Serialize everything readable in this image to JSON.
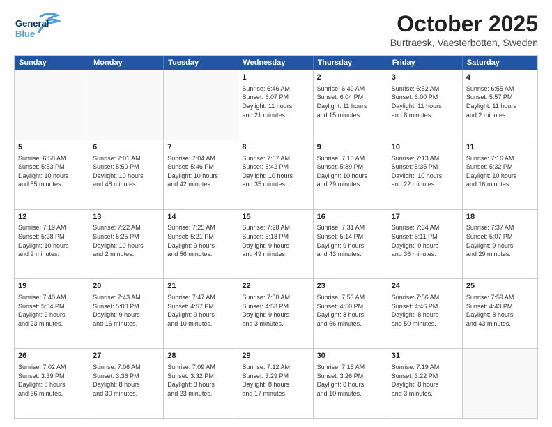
{
  "logo": {
    "line1": "General",
    "line2": "Blue"
  },
  "title": "October 2025",
  "subtitle": "Burtraesk, Vaesterbotten, Sweden",
  "weekdays": [
    "Sunday",
    "Monday",
    "Tuesday",
    "Wednesday",
    "Thursday",
    "Friday",
    "Saturday"
  ],
  "rows": [
    [
      {
        "day": "",
        "lines": []
      },
      {
        "day": "",
        "lines": []
      },
      {
        "day": "",
        "lines": []
      },
      {
        "day": "1",
        "lines": [
          "Sunrise: 6:46 AM",
          "Sunset: 6:07 PM",
          "Daylight: 11 hours",
          "and 21 minutes."
        ]
      },
      {
        "day": "2",
        "lines": [
          "Sunrise: 6:49 AM",
          "Sunset: 6:04 PM",
          "Daylight: 11 hours",
          "and 15 minutes."
        ]
      },
      {
        "day": "3",
        "lines": [
          "Sunrise: 6:52 AM",
          "Sunset: 6:00 PM",
          "Daylight: 11 hours",
          "and 8 minutes."
        ]
      },
      {
        "day": "4",
        "lines": [
          "Sunrise: 6:55 AM",
          "Sunset: 5:57 PM",
          "Daylight: 11 hours",
          "and 2 minutes."
        ]
      }
    ],
    [
      {
        "day": "5",
        "lines": [
          "Sunrise: 6:58 AM",
          "Sunset: 5:53 PM",
          "Daylight: 10 hours",
          "and 55 minutes."
        ]
      },
      {
        "day": "6",
        "lines": [
          "Sunrise: 7:01 AM",
          "Sunset: 5:50 PM",
          "Daylight: 10 hours",
          "and 48 minutes."
        ]
      },
      {
        "day": "7",
        "lines": [
          "Sunrise: 7:04 AM",
          "Sunset: 5:46 PM",
          "Daylight: 10 hours",
          "and 42 minutes."
        ]
      },
      {
        "day": "8",
        "lines": [
          "Sunrise: 7:07 AM",
          "Sunset: 5:42 PM",
          "Daylight: 10 hours",
          "and 35 minutes."
        ]
      },
      {
        "day": "9",
        "lines": [
          "Sunrise: 7:10 AM",
          "Sunset: 5:39 PM",
          "Daylight: 10 hours",
          "and 29 minutes."
        ]
      },
      {
        "day": "10",
        "lines": [
          "Sunrise: 7:13 AM",
          "Sunset: 5:35 PM",
          "Daylight: 10 hours",
          "and 22 minutes."
        ]
      },
      {
        "day": "11",
        "lines": [
          "Sunrise: 7:16 AM",
          "Sunset: 5:32 PM",
          "Daylight: 10 hours",
          "and 16 minutes."
        ]
      }
    ],
    [
      {
        "day": "12",
        "lines": [
          "Sunrise: 7:19 AM",
          "Sunset: 5:28 PM",
          "Daylight: 10 hours",
          "and 9 minutes."
        ]
      },
      {
        "day": "13",
        "lines": [
          "Sunrise: 7:22 AM",
          "Sunset: 5:25 PM",
          "Daylight: 10 hours",
          "and 2 minutes."
        ]
      },
      {
        "day": "14",
        "lines": [
          "Sunrise: 7:25 AM",
          "Sunset: 5:21 PM",
          "Daylight: 9 hours",
          "and 56 minutes."
        ]
      },
      {
        "day": "15",
        "lines": [
          "Sunrise: 7:28 AM",
          "Sunset: 5:18 PM",
          "Daylight: 9 hours",
          "and 49 minutes."
        ]
      },
      {
        "day": "16",
        "lines": [
          "Sunrise: 7:31 AM",
          "Sunset: 5:14 PM",
          "Daylight: 9 hours",
          "and 43 minutes."
        ]
      },
      {
        "day": "17",
        "lines": [
          "Sunrise: 7:34 AM",
          "Sunset: 5:11 PM",
          "Daylight: 9 hours",
          "and 36 minutes."
        ]
      },
      {
        "day": "18",
        "lines": [
          "Sunrise: 7:37 AM",
          "Sunset: 5:07 PM",
          "Daylight: 9 hours",
          "and 29 minutes."
        ]
      }
    ],
    [
      {
        "day": "19",
        "lines": [
          "Sunrise: 7:40 AM",
          "Sunset: 5:04 PM",
          "Daylight: 9 hours",
          "and 23 minutes."
        ]
      },
      {
        "day": "20",
        "lines": [
          "Sunrise: 7:43 AM",
          "Sunset: 5:00 PM",
          "Daylight: 9 hours",
          "and 16 minutes."
        ]
      },
      {
        "day": "21",
        "lines": [
          "Sunrise: 7:47 AM",
          "Sunset: 4:57 PM",
          "Daylight: 9 hours",
          "and 10 minutes."
        ]
      },
      {
        "day": "22",
        "lines": [
          "Sunrise: 7:50 AM",
          "Sunset: 4:53 PM",
          "Daylight: 9 hours",
          "and 3 minutes."
        ]
      },
      {
        "day": "23",
        "lines": [
          "Sunrise: 7:53 AM",
          "Sunset: 4:50 PM",
          "Daylight: 8 hours",
          "and 56 minutes."
        ]
      },
      {
        "day": "24",
        "lines": [
          "Sunrise: 7:56 AM",
          "Sunset: 4:46 PM",
          "Daylight: 8 hours",
          "and 50 minutes."
        ]
      },
      {
        "day": "25",
        "lines": [
          "Sunrise: 7:59 AM",
          "Sunset: 4:43 PM",
          "Daylight: 8 hours",
          "and 43 minutes."
        ]
      }
    ],
    [
      {
        "day": "26",
        "lines": [
          "Sunrise: 7:02 AM",
          "Sunset: 3:39 PM",
          "Daylight: 8 hours",
          "and 36 minutes."
        ]
      },
      {
        "day": "27",
        "lines": [
          "Sunrise: 7:06 AM",
          "Sunset: 3:36 PM",
          "Daylight: 8 hours",
          "and 30 minutes."
        ]
      },
      {
        "day": "28",
        "lines": [
          "Sunrise: 7:09 AM",
          "Sunset: 3:32 PM",
          "Daylight: 8 hours",
          "and 23 minutes."
        ]
      },
      {
        "day": "29",
        "lines": [
          "Sunrise: 7:12 AM",
          "Sunset: 3:29 PM",
          "Daylight: 8 hours",
          "and 17 minutes."
        ]
      },
      {
        "day": "30",
        "lines": [
          "Sunrise: 7:15 AM",
          "Sunset: 3:26 PM",
          "Daylight: 8 hours",
          "and 10 minutes."
        ]
      },
      {
        "day": "31",
        "lines": [
          "Sunrise: 7:19 AM",
          "Sunset: 3:22 PM",
          "Daylight: 8 hours",
          "and 3 minutes."
        ]
      },
      {
        "day": "",
        "lines": []
      }
    ]
  ]
}
